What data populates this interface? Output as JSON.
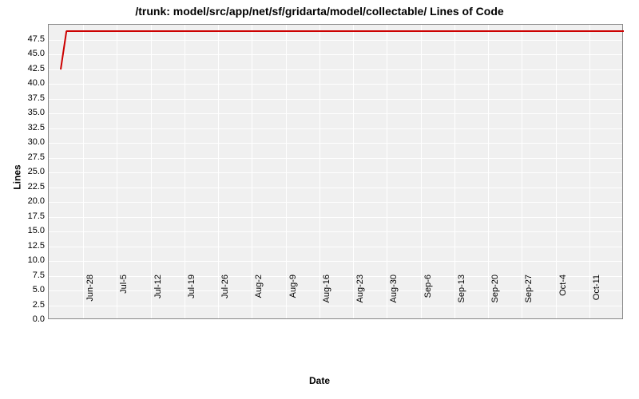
{
  "chart_data": {
    "type": "line",
    "title": "/trunk: model/src/app/net/sf/gridarta/model/collectable/ Lines of Code",
    "xlabel": "Date",
    "ylabel": "Lines",
    "ylim": [
      0,
      50
    ],
    "y_ticks": [
      0.0,
      2.5,
      5.0,
      7.5,
      10.0,
      12.5,
      15.0,
      17.5,
      20.0,
      22.5,
      25.0,
      27.5,
      30.0,
      32.5,
      35.0,
      37.5,
      40.0,
      42.5,
      45.0,
      47.5
    ],
    "x_categories": [
      "28-Jun",
      "5-Jul",
      "12-Jul",
      "19-Jul",
      "26-Jul",
      "2-Aug",
      "9-Aug",
      "16-Aug",
      "23-Aug",
      "30-Aug",
      "6-Sep",
      "13-Sep",
      "20-Sep",
      "27-Sep",
      "4-Oct",
      "11-Oct"
    ],
    "series": [
      {
        "name": "Lines of Code",
        "color": "#cc0000",
        "points": [
          {
            "x_frac": 0.02,
            "y": 42.5
          },
          {
            "x_frac": 0.03,
            "y": 49.0
          },
          {
            "x_frac": 1.0,
            "y": 49.0
          }
        ]
      }
    ]
  }
}
